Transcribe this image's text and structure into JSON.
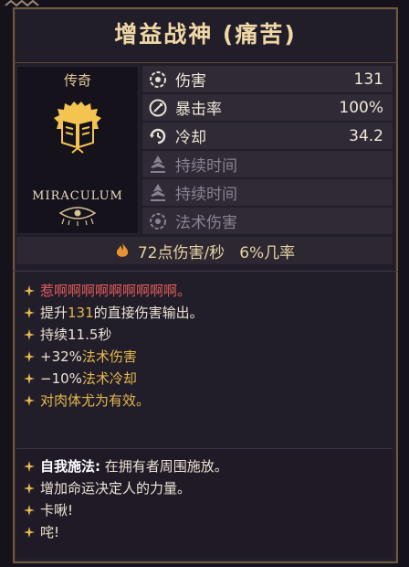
{
  "title": "增益战神 (痛苦)",
  "rarity": "传奇",
  "brand": "MIRACULUM",
  "stats": [
    {
      "icon": "damage-icon",
      "label": "伤害",
      "value": "131",
      "dim": false
    },
    {
      "icon": "crit-icon",
      "label": "暴击率",
      "value": "100%",
      "dim": false
    },
    {
      "icon": "cooldown-icon",
      "label": "冷却",
      "value": "34.2",
      "dim": false
    },
    {
      "icon": "duration-icon",
      "label": "持续时间",
      "value": "",
      "dim": true
    },
    {
      "icon": "duration-icon",
      "label": "持续时间",
      "value": "",
      "dim": true
    },
    {
      "icon": "spell-damage-icon",
      "label": "法术伤害",
      "value": "",
      "dim": true
    }
  ],
  "dps": {
    "icon": "flame-icon",
    "text": "72点伤害/秒",
    "proc": "6%几率"
  },
  "description": [
    {
      "parts": [
        {
          "text": "惹啊啊啊啊啊啊啊啊啊。",
          "style": "red"
        }
      ]
    },
    {
      "parts": [
        {
          "text": "提升",
          "style": ""
        },
        {
          "text": "131",
          "style": "gold"
        },
        {
          "text": "的直接伤害输出。",
          "style": ""
        }
      ]
    },
    {
      "parts": [
        {
          "text": "持续11.5秒",
          "style": ""
        }
      ]
    },
    {
      "parts": [
        {
          "text": "+32%",
          "style": ""
        },
        {
          "text": "法术伤害",
          "style": "gold"
        }
      ]
    },
    {
      "parts": [
        {
          "text": "−10%",
          "style": ""
        },
        {
          "text": "法术冷却",
          "style": "gold"
        }
      ]
    },
    {
      "parts": [
        {
          "text": "对肉体尤为有效。",
          "style": "gold"
        }
      ]
    }
  ],
  "lore": [
    {
      "parts": [
        {
          "text": "自我施法:",
          "style": "bold-white"
        },
        {
          "text": " 在拥有者周围施放。",
          "style": ""
        }
      ]
    },
    {
      "parts": [
        {
          "text": "增加命运决定人的力量。",
          "style": ""
        }
      ]
    },
    {
      "parts": [
        {
          "text": "卡啾!",
          "style": ""
        }
      ]
    },
    {
      "parts": [
        {
          "text": "咤!",
          "style": ""
        }
      ]
    }
  ],
  "colors": {
    "accent": "#e6b84e",
    "title": "#f0d8a6",
    "warning": "#e25d5d",
    "background": "#211d29"
  }
}
